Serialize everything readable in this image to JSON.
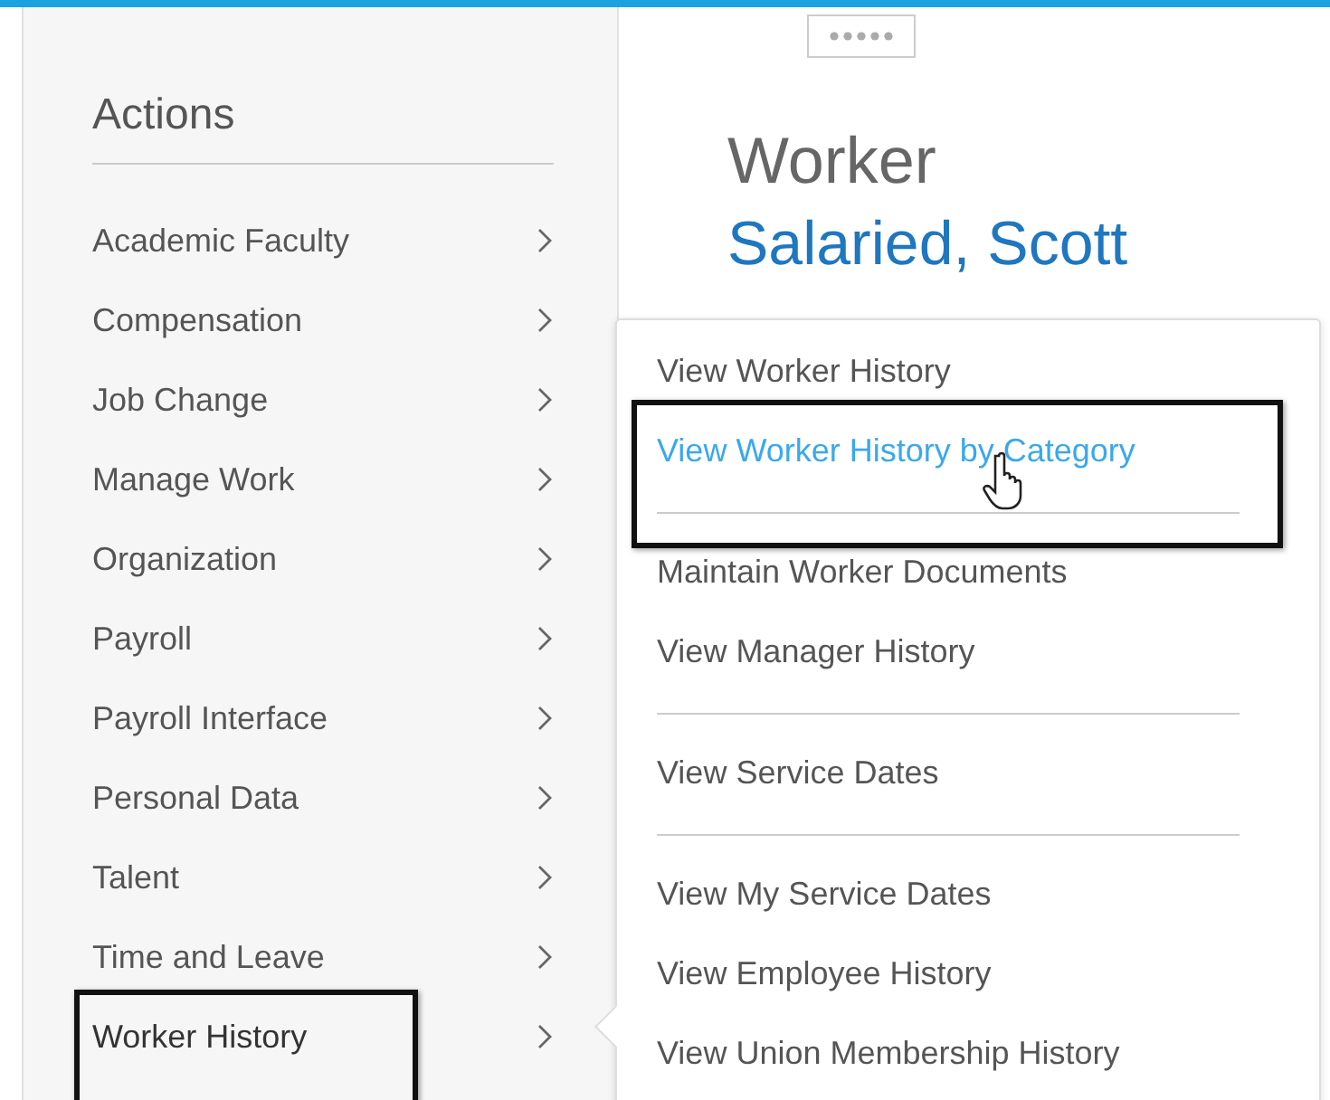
{
  "actions": {
    "title": "Actions",
    "items": [
      {
        "label": "Academic Faculty",
        "selected": false,
        "annotated": false
      },
      {
        "label": "Compensation",
        "selected": false,
        "annotated": false
      },
      {
        "label": "Job Change",
        "selected": false,
        "annotated": false
      },
      {
        "label": "Manage Work",
        "selected": false,
        "annotated": false
      },
      {
        "label": "Organization",
        "selected": false,
        "annotated": false
      },
      {
        "label": "Payroll",
        "selected": false,
        "annotated": false
      },
      {
        "label": "Payroll Interface",
        "selected": false,
        "annotated": false
      },
      {
        "label": "Personal Data",
        "selected": false,
        "annotated": false
      },
      {
        "label": "Talent",
        "selected": false,
        "annotated": false
      },
      {
        "label": "Time and Leave",
        "selected": false,
        "annotated": false
      },
      {
        "label": "Worker History",
        "selected": true,
        "annotated": true
      }
    ]
  },
  "header": {
    "label": "Worker",
    "name": "Salaried, Scott"
  },
  "submenu": {
    "groups": [
      [
        {
          "label": "View Worker History",
          "selected": false,
          "annotated": false
        },
        {
          "label": "View Worker History by Category",
          "selected": true,
          "annotated": true
        }
      ],
      [
        {
          "label": "Maintain Worker Documents",
          "selected": false,
          "annotated": false
        },
        {
          "label": "View Manager History",
          "selected": false,
          "annotated": false
        }
      ],
      [
        {
          "label": "View Service Dates",
          "selected": false,
          "annotated": false
        }
      ],
      [
        {
          "label": "View My Service Dates",
          "selected": false,
          "annotated": false
        },
        {
          "label": "View Employee History",
          "selected": false,
          "annotated": false
        },
        {
          "label": "View Union Membership History",
          "selected": false,
          "annotated": false
        }
      ]
    ]
  }
}
